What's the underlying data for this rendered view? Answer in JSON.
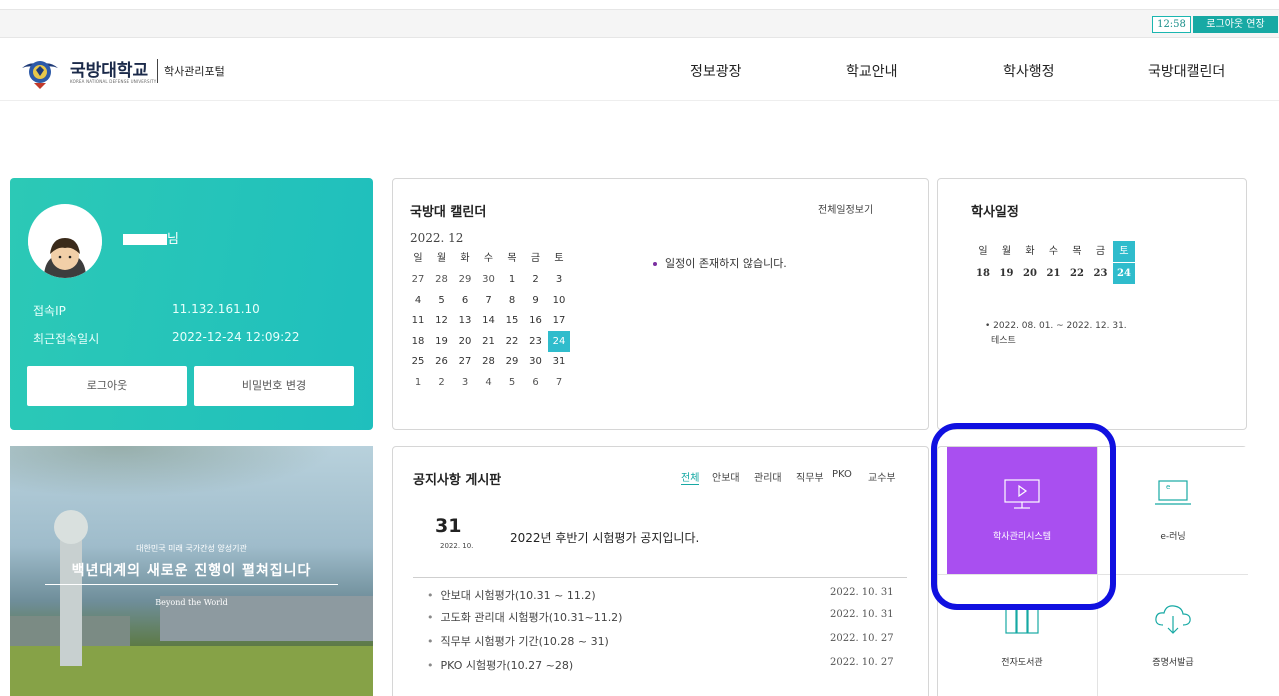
{
  "topbar": {
    "timer": "12:58",
    "extend_label": "로그아웃 연장"
  },
  "header": {
    "logo_name": "국방대학교",
    "logo_sub": "KOREA NATIONAL DEFENSE UNIVERSITY",
    "portal_name": "학사관리포털",
    "nav": [
      "정보광장",
      "학교안내",
      "학사행정",
      "국방대캘린더"
    ]
  },
  "profile": {
    "name_suffix": "님",
    "ip_label": "접속IP",
    "ip_value": "11.132.161.10",
    "last_login_label": "최근접속일시",
    "last_login_value": "2022-12-24 12:09:22",
    "logout_label": "로그아웃",
    "change_pw_label": "비밀번호 변경"
  },
  "banner": {
    "line1": "대한민국 미래 국가간성 양성기관",
    "line2": "백년대계의 새로운 진행이 펼쳐집니다",
    "line3": "Beyond the World"
  },
  "calendar": {
    "title": "국방대 캘린더",
    "all_link": "전체일정보기",
    "month": "2022. 12",
    "weekdays": [
      "일",
      "월",
      "화",
      "수",
      "목",
      "금",
      "토"
    ],
    "weeks": [
      [
        "27",
        "28",
        "29",
        "30",
        "1",
        "2",
        "3"
      ],
      [
        "4",
        "5",
        "6",
        "7",
        "8",
        "9",
        "10"
      ],
      [
        "11",
        "12",
        "13",
        "14",
        "15",
        "16",
        "17"
      ],
      [
        "18",
        "19",
        "20",
        "21",
        "22",
        "23",
        "24"
      ],
      [
        "25",
        "26",
        "27",
        "28",
        "29",
        "30",
        "31"
      ],
      [
        "1",
        "2",
        "3",
        "4",
        "5",
        "6",
        "7"
      ]
    ],
    "today": "24",
    "empty_text": "일정이 존재하지 않습니다."
  },
  "schedule": {
    "title": "학사일정",
    "weekdays": [
      "일",
      "월",
      "화",
      "수",
      "목",
      "금",
      "토"
    ],
    "days": [
      "18",
      "19",
      "20",
      "21",
      "22",
      "23",
      "24"
    ],
    "item_period": "2022. 08. 01. ~ 2022. 12. 31.",
    "item_name": "테스트"
  },
  "notice": {
    "title": "공지사항 게시판",
    "tabs": [
      "전체",
      "안보대",
      "관리대",
      "직무부",
      "PKO",
      "교수부"
    ],
    "featured_day": "31",
    "featured_ym": "2022. 10.",
    "featured_title": "2022년 후반기 시험평가 공지입니다.",
    "items": [
      {
        "title": "안보대 시험평가(10.31 ~ 11.2)",
        "date": "2022. 10. 31"
      },
      {
        "title": "고도화 관리대 시험평가(10.31~11.2)",
        "date": "2022. 10. 31"
      },
      {
        "title": "직무부 시험평가 기간(10.28 ~ 31)",
        "date": "2022. 10. 27"
      },
      {
        "title": "PKO 시험평가(10.27 ~28)",
        "date": "2022. 10. 27"
      }
    ]
  },
  "quick_links": [
    {
      "label": "학사관리시스템",
      "icon": "monitor-play-icon"
    },
    {
      "label": "e-러닝",
      "icon": "laptop-icon"
    },
    {
      "label": "전자도서관",
      "icon": "books-icon"
    },
    {
      "label": "증명서발급",
      "icon": "cloud-download-icon"
    }
  ],
  "colors": {
    "teal": "#1fbfbd",
    "purple_active": "#a94ff0",
    "highlight": "#1010e0"
  }
}
